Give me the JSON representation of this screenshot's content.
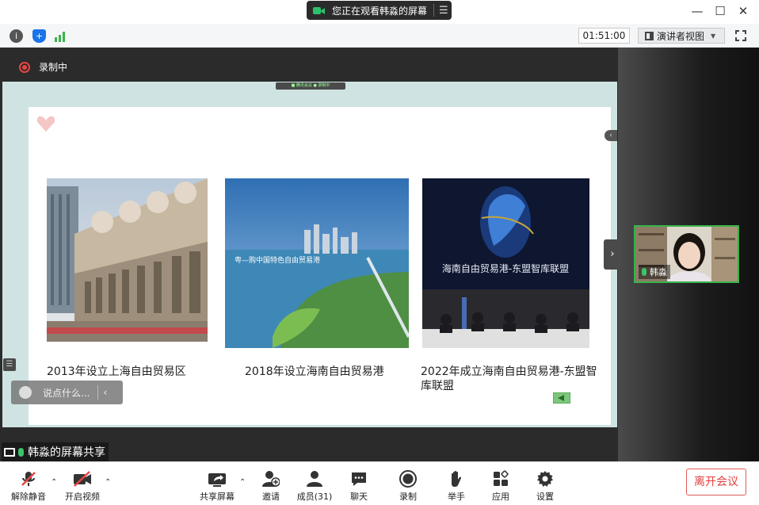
{
  "titlebar": {
    "share_notice": "您正在观看韩淼的屏幕",
    "menu_glyph": "☰",
    "minimize": "—",
    "maximize": "☐",
    "close": "✕"
  },
  "infobar": {
    "timer": "01:51:00",
    "view_mode": "演讲者视图",
    "view_caret": "▼"
  },
  "main": {
    "recording_label": "录制中",
    "mini_bar_text": "■ 腾讯会议  ● 录制中",
    "share_label": "韩淼的屏幕共享",
    "chat_placeholder": "说点什么...",
    "chat_arrow": "‹",
    "side_toggle": "›",
    "collapse_glyph": "‹",
    "chat_list_glyph": "☰"
  },
  "slide": {
    "items": [
      {
        "caption": "2013年设立上海自由贸易区"
      },
      {
        "caption": "2018年设立海南自由贸易港"
      },
      {
        "caption": "2022年成立海南自由贸易港-东盟智库联盟"
      }
    ],
    "banner_text": "海南自由贸易港-东盟智库联盟",
    "photo2_text": "粤—购中国特色自由贸易港"
  },
  "participant": {
    "name": "韩淼"
  },
  "toolbar": {
    "buttons": [
      {
        "label": "解除静音",
        "icon": "mic-muted-icon"
      },
      {
        "label": "开启视频",
        "icon": "camera-off-icon"
      },
      {
        "label": "共享屏幕",
        "icon": "share-screen-icon"
      },
      {
        "label": "邀请",
        "icon": "invite-icon"
      },
      {
        "label": "成员(31)",
        "icon": "members-icon"
      },
      {
        "label": "聊天",
        "icon": "chat-icon"
      },
      {
        "label": "录制",
        "icon": "record-icon"
      },
      {
        "label": "举手",
        "icon": "raise-hand-icon"
      },
      {
        "label": "应用",
        "icon": "apps-icon"
      },
      {
        "label": "设置",
        "icon": "settings-icon"
      }
    ],
    "leave_label": "离开会议",
    "caret_glyph": "⌃"
  },
  "colors": {
    "accent_green": "#37b34a",
    "record_red": "#e84545",
    "leave_red": "#e0403f"
  }
}
